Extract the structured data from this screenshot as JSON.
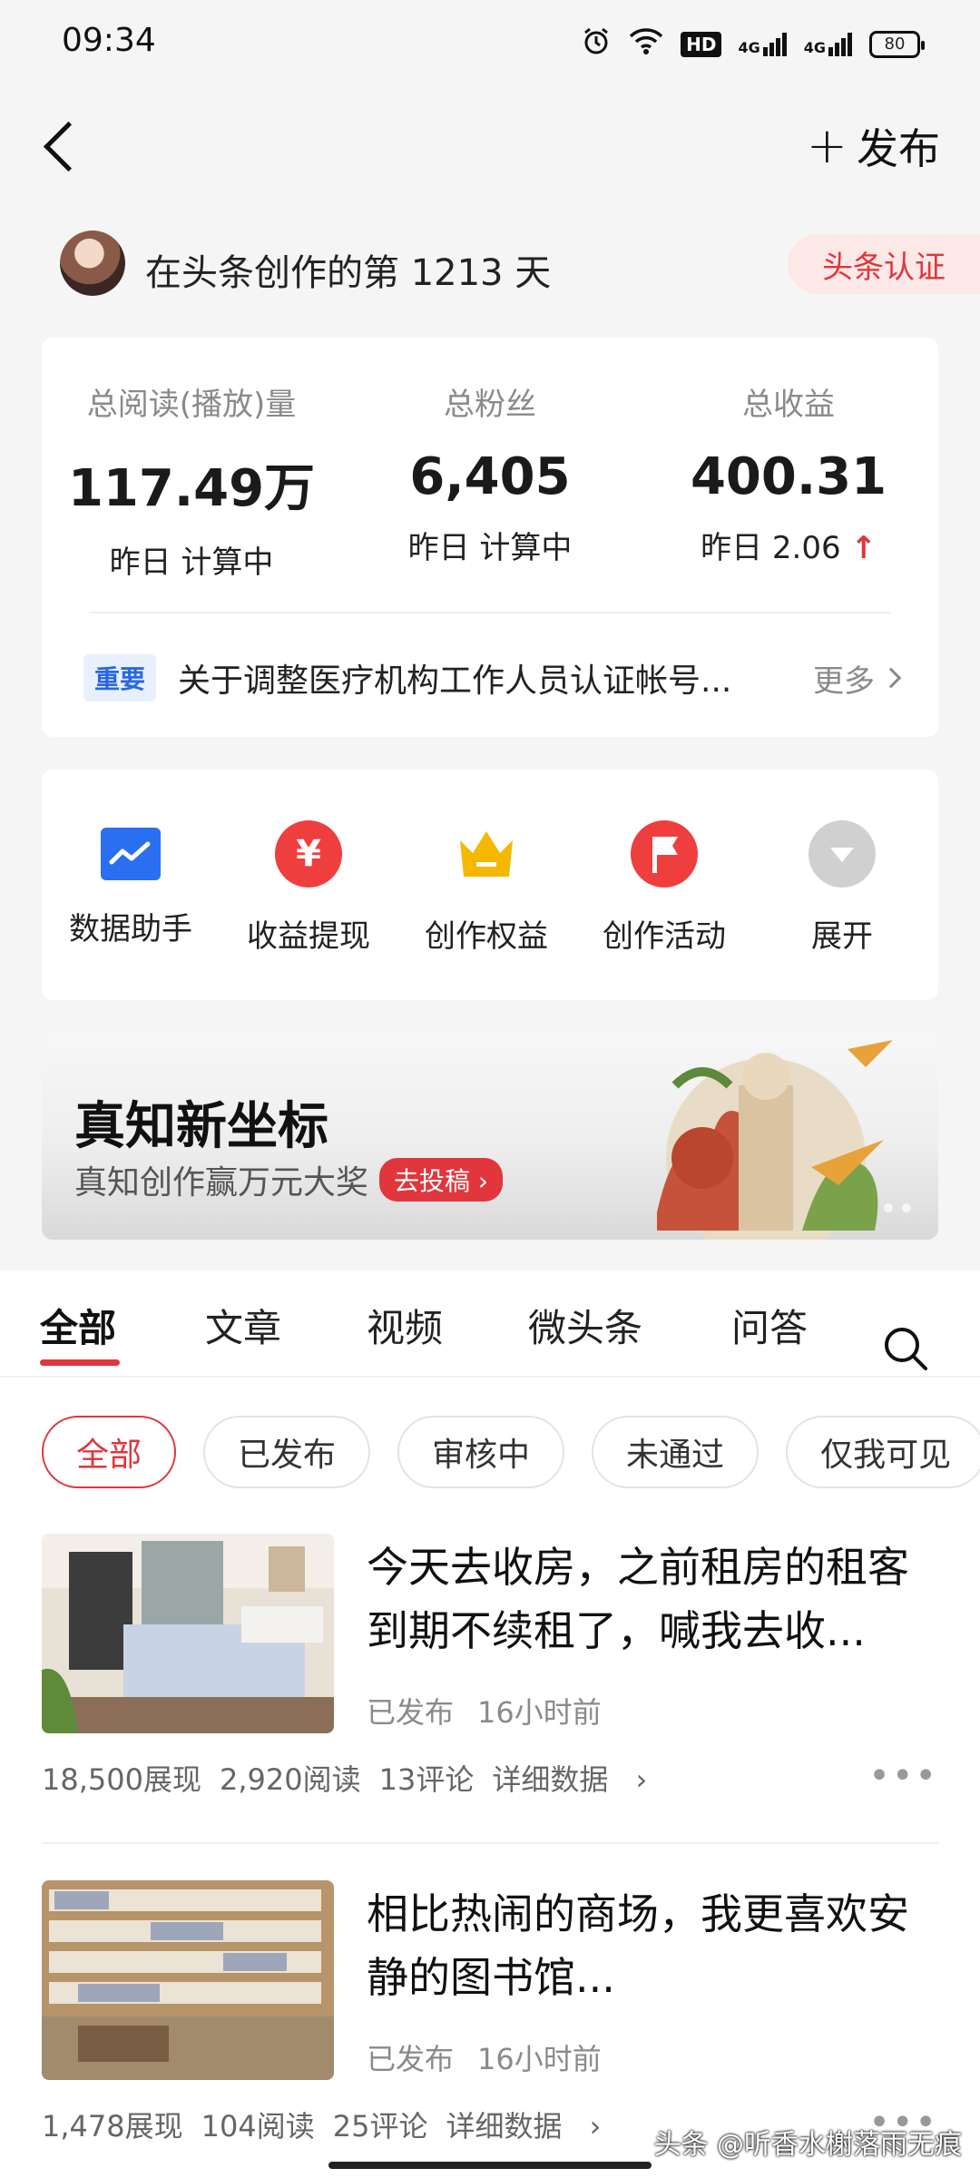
{
  "status_bar": {
    "time": "09:34",
    "battery": "80",
    "network1": "4G",
    "network2": "4G",
    "hd": "HD"
  },
  "nav": {
    "publish_label": "发布"
  },
  "creator": {
    "text": "在头条创作的第 1213 天",
    "badge": "头条认证"
  },
  "stats": [
    {
      "label": "总阅读(播放)量",
      "value": "117.49万",
      "sub": "昨日 计算中"
    },
    {
      "label": "总粉丝",
      "value": "6,405",
      "sub": "昨日 计算中"
    },
    {
      "label": "总收益",
      "value": "400.31",
      "sub": "昨日 2.06",
      "trend": "↑"
    }
  ],
  "notice": {
    "tag": "重要",
    "text": "关于调整医疗机构工作人员认证帐号...",
    "more": "更多"
  },
  "tools": [
    {
      "label": "数据助手",
      "icon": "chart-icon"
    },
    {
      "label": "收益提现",
      "icon": "yuan-icon",
      "glyph": "¥"
    },
    {
      "label": "创作权益",
      "icon": "crown-icon"
    },
    {
      "label": "创作活动",
      "icon": "flag-icon"
    },
    {
      "label": "展开",
      "icon": "expand-icon"
    }
  ],
  "banner": {
    "title": "真知新坐标",
    "subtitle": "真知创作赢万元大奖",
    "button": "去投稿"
  },
  "tabs": [
    "全部",
    "文章",
    "视频",
    "微头条",
    "问答"
  ],
  "chips": [
    "全部",
    "已发布",
    "审核中",
    "未通过",
    "仅我可见"
  ],
  "articles": [
    {
      "title": "今天去收房，之前租房的租客到期不续租了，喊我去收...",
      "status": "已发布",
      "time": "16小时前",
      "impressions": "18,500展现",
      "reads": "2,920阅读",
      "comments": "13评论",
      "detail": "详细数据"
    },
    {
      "title": "相比热闹的商场，我更喜欢安静的图书馆...",
      "status": "已发布",
      "time": "16小时前",
      "impressions": "1,478展现",
      "reads": "104阅读",
      "comments": "25评论",
      "detail": "详细数据"
    }
  ],
  "watermark": "头条 @听香水榭落雨无痕",
  "colors": {
    "accent": "#e0363c",
    "blue": "#2a6ff0",
    "crown": "#f5b800"
  }
}
